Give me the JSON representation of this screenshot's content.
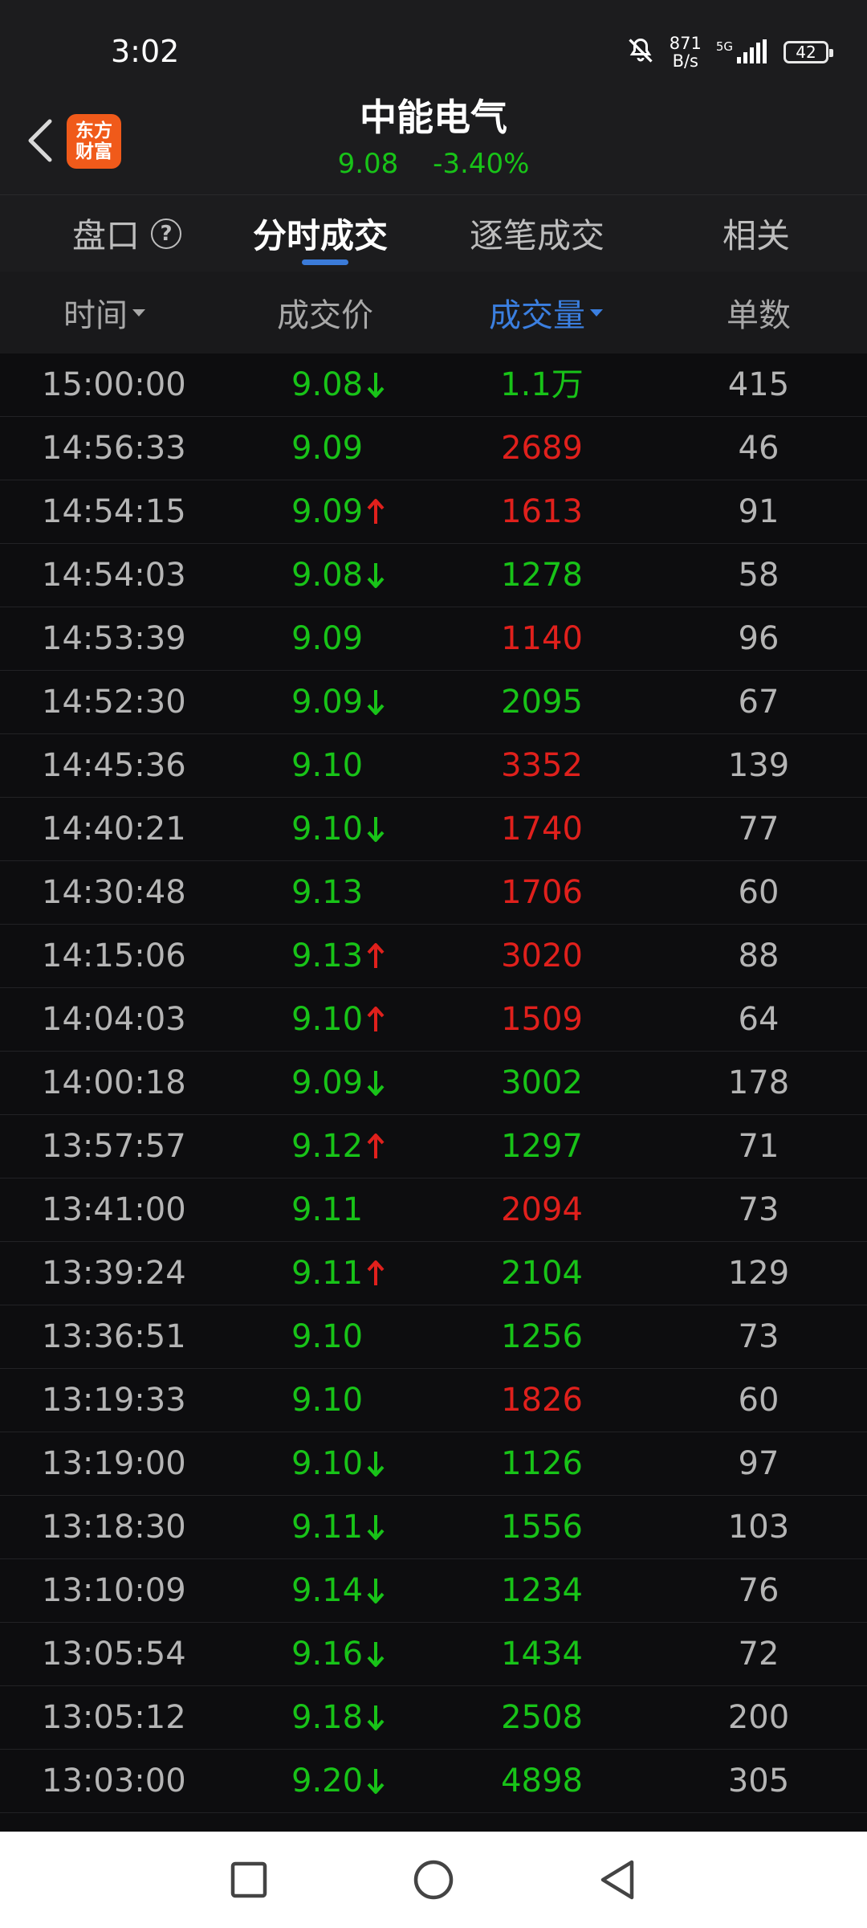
{
  "status_bar": {
    "time": "3:02",
    "net_speed_value": "871",
    "net_speed_unit": "B/s",
    "signal_label": "5G",
    "battery": "42",
    "icons": [
      "bell-muted-icon",
      "signal-icon",
      "battery-icon"
    ]
  },
  "header": {
    "app_logo_line1": "东方",
    "app_logo_line2": "财富",
    "stock_name": "中能电气",
    "price": "9.08",
    "change_pct": "-3.40%"
  },
  "tabs": [
    {
      "label": "盘口",
      "active": false
    },
    {
      "label": "分时成交",
      "active": true
    },
    {
      "label": "逐笔成交",
      "active": false
    },
    {
      "label": "相关",
      "active": false
    }
  ],
  "columns": [
    {
      "label": "时间",
      "sortable": true,
      "sorted": false
    },
    {
      "label": "成交价",
      "sortable": false,
      "sorted": false
    },
    {
      "label": "成交量",
      "sortable": true,
      "sorted": true
    },
    {
      "label": "单数",
      "sortable": false,
      "sorted": false
    }
  ],
  "colors": {
    "up": "#e0201c",
    "down": "#18c318",
    "accent": "#3b7fe0",
    "logo": "#f05a1a"
  },
  "trades": [
    {
      "time": "15:00:00",
      "price": "9.08",
      "dir": "down",
      "volume": "1.1万",
      "vol_color": "green",
      "count": "415"
    },
    {
      "time": "14:56:33",
      "price": "9.09",
      "dir": "",
      "volume": "2689",
      "vol_color": "red",
      "count": "46"
    },
    {
      "time": "14:54:15",
      "price": "9.09",
      "dir": "up",
      "volume": "1613",
      "vol_color": "red",
      "count": "91"
    },
    {
      "time": "14:54:03",
      "price": "9.08",
      "dir": "down",
      "volume": "1278",
      "vol_color": "green",
      "count": "58"
    },
    {
      "time": "14:53:39",
      "price": "9.09",
      "dir": "",
      "volume": "1140",
      "vol_color": "red",
      "count": "96"
    },
    {
      "time": "14:52:30",
      "price": "9.09",
      "dir": "down",
      "volume": "2095",
      "vol_color": "green",
      "count": "67"
    },
    {
      "time": "14:45:36",
      "price": "9.10",
      "dir": "",
      "volume": "3352",
      "vol_color": "red",
      "count": "139"
    },
    {
      "time": "14:40:21",
      "price": "9.10",
      "dir": "down",
      "volume": "1740",
      "vol_color": "red",
      "count": "77"
    },
    {
      "time": "14:30:48",
      "price": "9.13",
      "dir": "",
      "volume": "1706",
      "vol_color": "red",
      "count": "60"
    },
    {
      "time": "14:15:06",
      "price": "9.13",
      "dir": "up",
      "volume": "3020",
      "vol_color": "red",
      "count": "88"
    },
    {
      "time": "14:04:03",
      "price": "9.10",
      "dir": "up",
      "volume": "1509",
      "vol_color": "red",
      "count": "64"
    },
    {
      "time": "14:00:18",
      "price": "9.09",
      "dir": "down",
      "volume": "3002",
      "vol_color": "green",
      "count": "178"
    },
    {
      "time": "13:57:57",
      "price": "9.12",
      "dir": "up",
      "volume": "1297",
      "vol_color": "green",
      "count": "71"
    },
    {
      "time": "13:41:00",
      "price": "9.11",
      "dir": "",
      "volume": "2094",
      "vol_color": "red",
      "count": "73"
    },
    {
      "time": "13:39:24",
      "price": "9.11",
      "dir": "up",
      "volume": "2104",
      "vol_color": "green",
      "count": "129"
    },
    {
      "time": "13:36:51",
      "price": "9.10",
      "dir": "",
      "volume": "1256",
      "vol_color": "green",
      "count": "73"
    },
    {
      "time": "13:19:33",
      "price": "9.10",
      "dir": "",
      "volume": "1826",
      "vol_color": "red",
      "count": "60"
    },
    {
      "time": "13:19:00",
      "price": "9.10",
      "dir": "down",
      "volume": "1126",
      "vol_color": "green",
      "count": "97"
    },
    {
      "time": "13:18:30",
      "price": "9.11",
      "dir": "down",
      "volume": "1556",
      "vol_color": "green",
      "count": "103"
    },
    {
      "time": "13:10:09",
      "price": "9.14",
      "dir": "down",
      "volume": "1234",
      "vol_color": "green",
      "count": "76"
    },
    {
      "time": "13:05:54",
      "price": "9.16",
      "dir": "down",
      "volume": "1434",
      "vol_color": "green",
      "count": "72"
    },
    {
      "time": "13:05:12",
      "price": "9.18",
      "dir": "down",
      "volume": "2508",
      "vol_color": "green",
      "count": "200"
    },
    {
      "time": "13:03:00",
      "price": "9.20",
      "dir": "down",
      "volume": "4898",
      "vol_color": "green",
      "count": "305"
    }
  ],
  "nav_bar": {
    "buttons": [
      "recents-icon",
      "home-icon",
      "back-nav-icon"
    ]
  }
}
